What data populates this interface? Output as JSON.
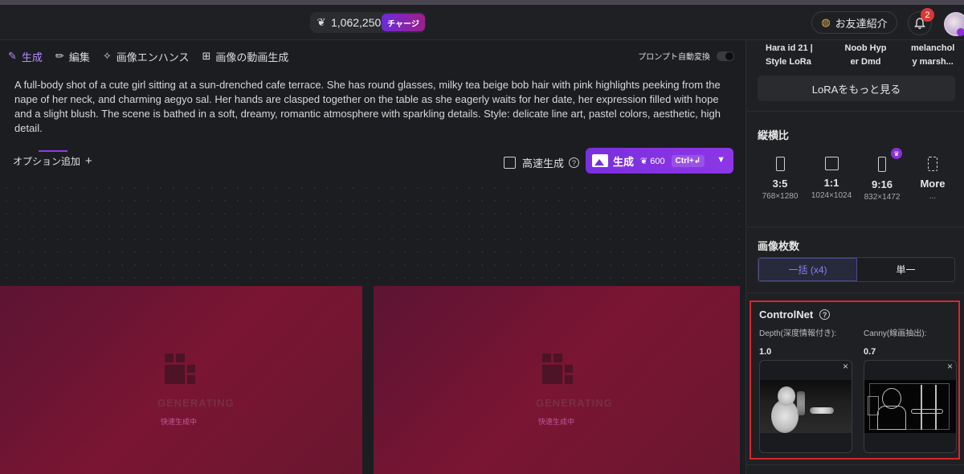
{
  "header": {
    "credits": "1,062,250",
    "charge_label": "チャージ",
    "invite_label": "お友達紹介",
    "notification_count": "2"
  },
  "tabs": [
    {
      "label": "生成",
      "icon": "brush-icon",
      "active": true
    },
    {
      "label": "編集",
      "icon": "pencil-icon",
      "active": false
    },
    {
      "label": "画像エンハンス",
      "icon": "enhance-icon",
      "active": false
    },
    {
      "label": "画像の動画生成",
      "icon": "video-gen-icon",
      "active": false
    }
  ],
  "auto_convert_label": "プロンプト自動変換",
  "prompt": "A full-body shot of a cute girl sitting at a sun-drenched cafe terrace. She has round glasses, milky tea beige bob hair with pink highlights peeking from the nape of her neck, and charming aegyo sal. Her hands are clasped together on the table as she eagerly waits for her date, her expression filled with hope and a slight blush. The scene is bathed in a soft, dreamy, romantic atmosphere with sparkling details. Style: delicate line art, pastel colors, aesthetic, high detail.",
  "options_label": "オプション追加",
  "options_plus": "+",
  "fast_label": "高速生成",
  "generate": {
    "label": "生成",
    "cost": "600",
    "shortcut": "Ctrl+↲"
  },
  "cards": [
    {
      "status": "GENERATING",
      "tag": "快速生成中"
    },
    {
      "status": "GENERATING",
      "tag": "快速生成中"
    }
  ],
  "lora": {
    "items": [
      {
        "line1": "Hara id 21 |",
        "line2": "Style LoRa"
      },
      {
        "line1": "Noob Hyp",
        "line2": "er Dmd"
      },
      {
        "line1": "melanchol",
        "line2": "y marsh..."
      }
    ],
    "more_label": "LoRAをもっと見る"
  },
  "aspect": {
    "title": "縦横比",
    "options": [
      {
        "ratio": "3:5",
        "size": "768×1280"
      },
      {
        "ratio": "1:1",
        "size": "1024×1024"
      },
      {
        "ratio": "9:16",
        "size": "832×1472"
      },
      {
        "ratio": "More",
        "size": "..."
      }
    ]
  },
  "count": {
    "title": "画像枚数",
    "batch": "一括 (x4)",
    "single": "単一"
  },
  "controlnet": {
    "title": "ControlNet",
    "depth_label": "Depth(深度情報付き):",
    "depth_value": "1.0",
    "canny_label": "Canny(線画抽出):",
    "canny_value": "0.7"
  },
  "colors": {
    "accent": "#8d36e6",
    "highlight_border": "#d8262a",
    "card_bg": "#6e1532"
  }
}
